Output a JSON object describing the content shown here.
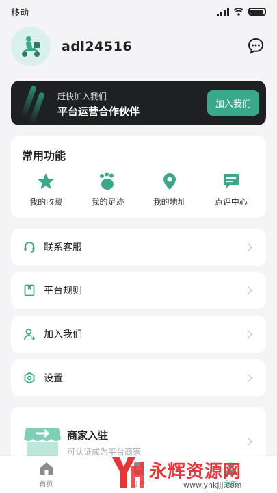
{
  "status_bar": {
    "carrier": "移动"
  },
  "profile": {
    "username": "adl24516"
  },
  "banner": {
    "subtitle": "赶快加入我们",
    "title": "平台运营合作伙伴",
    "button": "加入我们"
  },
  "functions": {
    "title": "常用功能",
    "items": [
      {
        "label": "我的收藏",
        "icon": "star-icon"
      },
      {
        "label": "我的足迹",
        "icon": "footprint-icon"
      },
      {
        "label": "我的地址",
        "icon": "location-pin-icon"
      },
      {
        "label": "点评中心",
        "icon": "review-chat-icon"
      }
    ]
  },
  "menu": [
    {
      "label": "联系客服",
      "icon": "headset-icon"
    },
    {
      "label": "平台规则",
      "icon": "book-icon"
    },
    {
      "label": "加入我们",
      "icon": "user-add-icon"
    },
    {
      "label": "设置",
      "icon": "gear-icon"
    }
  ],
  "merchant": {
    "title": "商家入驻",
    "subtitle": "可认证成为平台商家"
  },
  "tabbar": [
    {
      "label": "首页",
      "icon": "home-icon"
    },
    {
      "label": "订单",
      "icon": "order-icon"
    },
    {
      "label": "我的",
      "icon": "profile-icon"
    }
  ],
  "watermark": {
    "text": "永辉资源网",
    "url": "www.yhkjjj.com"
  },
  "colors": {
    "accent": "#3aa88b",
    "banner_bg": "#1e2022",
    "background": "#f4f4f6"
  }
}
